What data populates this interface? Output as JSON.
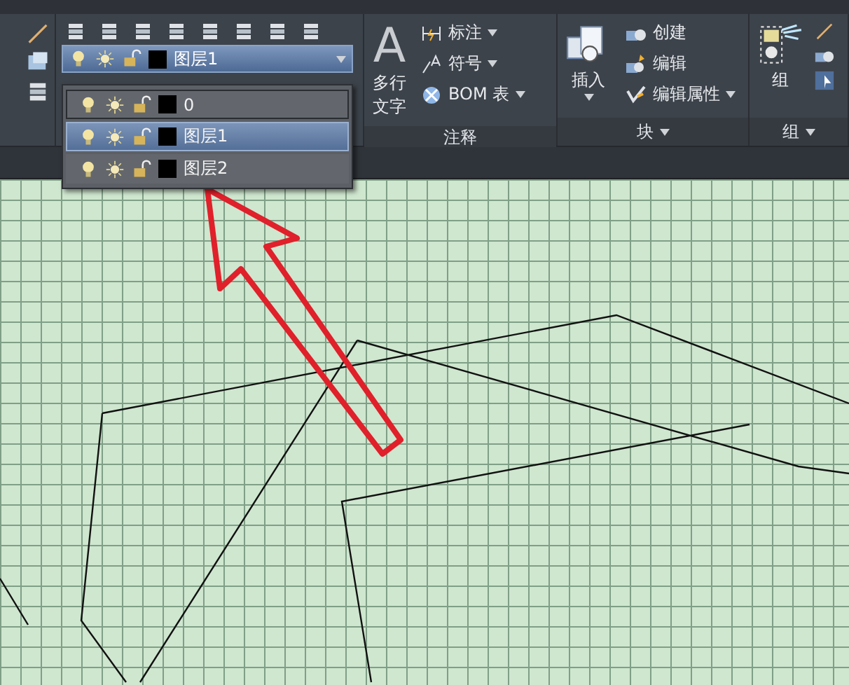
{
  "layer_combo": {
    "value": "图层1"
  },
  "layer_list": [
    {
      "name": "0",
      "selected": false,
      "hovered": true
    },
    {
      "name": "图层1",
      "selected": true,
      "hovered": false
    },
    {
      "name": "图层2",
      "selected": false,
      "hovered": false
    }
  ],
  "annotation_panel": {
    "title": "注释",
    "large_button": {
      "glyph": "A",
      "label_lines": [
        "多行",
        "文字"
      ]
    },
    "items": [
      {
        "label": "标注"
      },
      {
        "label": "符号"
      },
      {
        "label": "BOM 表"
      }
    ]
  },
  "block_panel": {
    "title": "块",
    "large_button": {
      "label": "插入"
    },
    "items": [
      {
        "label": "创建"
      },
      {
        "label": "编辑"
      },
      {
        "label": "编辑属性"
      }
    ]
  },
  "group_panel": {
    "title": "组",
    "large_button": {
      "label": "组"
    }
  }
}
